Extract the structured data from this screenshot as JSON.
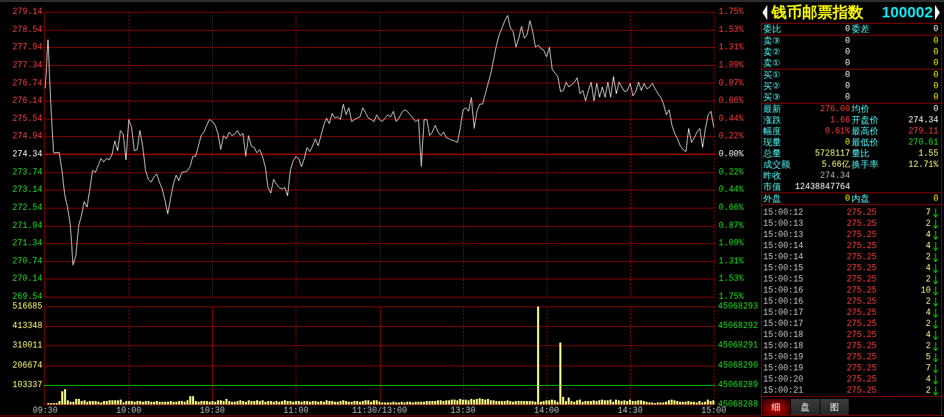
{
  "price_chart": {
    "percent_labels": [
      "1.75%",
      "1.53%",
      "1.31%",
      "1.09%",
      "0.87%",
      "0.66%",
      "0.44%",
      "0.22%",
      "0.00%",
      "0.22%",
      "0.44%",
      "0.66%",
      "0.87%",
      "1.09%",
      "1.31%",
      "1.53%",
      "1.75%"
    ],
    "chart_data": {
      "type": "line",
      "grid": true,
      "ref_lines": [
        {
          "axis": "y",
          "value": 274.34
        }
      ],
      "ylim": [
        269.54,
        279.14
      ],
      "yticks": [
        279.14,
        278.54,
        277.94,
        277.34,
        276.74,
        276.14,
        275.54,
        274.94,
        274.34,
        273.74,
        273.14,
        272.54,
        271.94,
        271.34,
        270.74,
        270.14,
        269.54
      ],
      "categories": [
        null,
        null,
        null,
        null,
        null,
        null,
        null,
        null,
        null,
        null,
        null,
        null,
        null,
        null,
        null,
        null,
        null,
        null,
        null,
        null,
        null,
        null,
        null,
        null,
        null,
        null,
        null,
        null,
        null,
        null,
        null,
        null,
        null,
        null,
        null,
        null,
        null,
        null,
        null,
        null,
        null,
        null,
        null,
        null,
        null,
        null,
        null,
        null,
        null,
        null,
        null,
        null,
        null,
        null,
        null,
        null,
        null,
        null,
        null,
        null,
        null,
        null,
        null,
        null,
        null,
        null,
        null,
        null,
        null,
        null,
        null,
        null,
        null,
        null,
        null,
        null,
        null,
        null,
        null,
        null,
        null,
        null,
        null,
        null,
        null,
        null,
        null,
        null,
        null,
        null,
        null,
        null,
        null,
        null,
        null,
        null,
        null,
        null,
        null,
        null,
        null,
        null,
        null,
        null,
        null,
        null,
        null,
        null,
        null,
        null,
        null,
        null,
        null,
        null,
        null,
        null,
        null,
        null,
        null,
        null,
        null,
        null,
        null,
        null,
        null,
        null,
        null,
        null,
        null,
        null,
        null,
        null,
        null,
        null,
        null,
        null,
        null,
        null,
        null,
        null,
        null,
        null,
        null,
        null,
        null,
        null,
        null,
        null,
        null,
        null,
        null,
        null,
        null,
        null,
        null,
        null,
        null,
        null,
        null,
        null,
        null,
        null,
        null,
        null,
        null,
        null,
        null,
        null,
        null,
        null,
        null,
        null,
        null,
        null,
        null,
        null,
        null,
        null,
        null,
        null,
        null,
        null,
        null,
        null,
        null,
        null,
        null,
        null,
        null,
        null,
        null,
        null,
        null,
        null,
        null,
        null,
        null,
        null,
        null,
        null,
        null,
        null,
        null,
        null,
        null,
        null,
        null,
        null,
        null,
        null,
        null,
        null,
        null,
        null,
        null,
        null,
        null,
        null,
        null,
        null,
        null,
        null,
        null,
        null,
        null,
        null,
        null,
        null,
        null,
        null,
        null,
        null,
        null,
        null,
        null,
        null,
        null,
        null,
        null,
        null,
        null
      ],
      "values": [
        276.56,
        278.2,
        276.03,
        274.39,
        274.39,
        274.41,
        273.8,
        272.98,
        272.56,
        271.98,
        270.61,
        270.92,
        271.93,
        272.28,
        272.75,
        272.56,
        273.15,
        273.8,
        273.73,
        273.96,
        274.2,
        274.08,
        274.2,
        274.15,
        274.34,
        274.79,
        274.46,
        275.14,
        275.02,
        274.15,
        275.51,
        275.25,
        274.46,
        274.5,
        275.14,
        274.62,
        273.8,
        273.5,
        273.4,
        273.57,
        273.68,
        273.4,
        273.17,
        272.79,
        272.33,
        272.86,
        273.33,
        273.64,
        273.45,
        273.73,
        273.75,
        273.78,
        273.92,
        274.27,
        274.27,
        274.62,
        274.97,
        275.09,
        275.32,
        275.51,
        275.44,
        275.32,
        275.04,
        274.5,
        274.97,
        274.86,
        275.09,
        274.97,
        275.02,
        275.14,
        274.97,
        275.04,
        274.27,
        274.97,
        274.62,
        274.57,
        274.39,
        274.5,
        274.27,
        273.92,
        273.22,
        273.03,
        273.5,
        273.33,
        273.22,
        273.17,
        273.22,
        272.94,
        273.8,
        274.11,
        274.27,
        274.2,
        273.92,
        274.2,
        274.57,
        274.43,
        274.62,
        274.86,
        274.62,
        274.97,
        275.32,
        275.56,
        275.37,
        275.72,
        275.56,
        275.6,
        275.51,
        276.03,
        275.67,
        275.91,
        275.44,
        275.51,
        275.56,
        275.6,
        275.91,
        275.74,
        275.56,
        275.51,
        275.44,
        275.67,
        275.51,
        275.44,
        275.56,
        275.67,
        275.6,
        275.79,
        275.44,
        275.56,
        275.74,
        275.84,
        275.79,
        275.67,
        275.56,
        275.44,
        275.51,
        273.92,
        275.51,
        275.51,
        274.97,
        275.09,
        275.32,
        275.09,
        274.97,
        275.09,
        274.9,
        274.86,
        274.81,
        274.79,
        274.74,
        275.21,
        275.84,
        275.91,
        275.79,
        276.26,
        275.21,
        275.79,
        276.03,
        276.03,
        276.38,
        276.73,
        277.08,
        277.55,
        278.02,
        278.37,
        278.6,
        278.84,
        279.02,
        278.6,
        278.48,
        277.95,
        278.25,
        278.65,
        278.25,
        278.37,
        278.84,
        278.48,
        277.95,
        278.02,
        277.9,
        277.85,
        277.62,
        277.95,
        277.2,
        277.08,
        276.96,
        276.45,
        276.49,
        276.77,
        276.61,
        276.68,
        276.77,
        276.92,
        276.38,
        276.49,
        276.14,
        276.49,
        276.77,
        276.14,
        276.73,
        276.26,
        276.61,
        276.26,
        276.77,
        276.26,
        276.96,
        276.38,
        276.77,
        276.61,
        276.45,
        276.49,
        276.73,
        276.31,
        276.45,
        276.77,
        276.49,
        276.73,
        276.54,
        276.61,
        276.73,
        276.54,
        276.38,
        276.26,
        276.03,
        275.67,
        275.84,
        275.32,
        275.04,
        274.86,
        274.62,
        274.5,
        274.43,
        275.21,
        274.74,
        274.9,
        275.09,
        275.21,
        274.57,
        275.21,
        275.67,
        275.79,
        275.25
      ]
    }
  },
  "volume_chart": {
    "right_labels": [
      "45068293",
      "45068292",
      "45068291",
      "45068290",
      "45068289",
      "45068288"
    ],
    "chart_data": {
      "type": "bar",
      "grid": true,
      "ref_lines": [
        {
          "axis": "y",
          "value": 103337
        }
      ],
      "ylim": [
        0,
        516685
      ],
      "yticks": [
        516685,
        413348,
        310011,
        206674,
        103337
      ],
      "categories": [
        "09:30",
        null,
        null,
        null,
        null,
        null,
        null,
        null,
        null,
        null,
        null,
        null,
        null,
        null,
        null,
        null,
        null,
        null,
        null,
        null,
        null,
        null,
        null,
        null,
        null,
        null,
        null,
        null,
        null,
        null,
        "10:00",
        null,
        null,
        null,
        null,
        null,
        null,
        null,
        null,
        null,
        null,
        null,
        null,
        null,
        null,
        null,
        null,
        null,
        null,
        null,
        null,
        null,
        null,
        null,
        null,
        null,
        null,
        null,
        null,
        null,
        "10:30",
        null,
        null,
        null,
        null,
        null,
        null,
        null,
        null,
        null,
        null,
        null,
        null,
        null,
        null,
        null,
        null,
        null,
        null,
        null,
        null,
        null,
        null,
        null,
        null,
        null,
        null,
        null,
        null,
        null,
        "11:00",
        null,
        null,
        null,
        null,
        null,
        null,
        null,
        null,
        null,
        null,
        null,
        null,
        null,
        null,
        null,
        null,
        null,
        null,
        null,
        null,
        null,
        null,
        null,
        null,
        null,
        null,
        null,
        null,
        null,
        "11:30/13:00",
        null,
        null,
        null,
        null,
        null,
        null,
        null,
        null,
        null,
        null,
        null,
        null,
        null,
        null,
        null,
        null,
        null,
        null,
        null,
        null,
        null,
        null,
        null,
        null,
        null,
        null,
        null,
        null,
        null,
        "13:30",
        null,
        null,
        null,
        null,
        null,
        null,
        null,
        null,
        null,
        null,
        null,
        null,
        null,
        null,
        null,
        null,
        null,
        null,
        null,
        null,
        null,
        null,
        null,
        null,
        null,
        null,
        null,
        null,
        null,
        "14:00",
        null,
        null,
        null,
        null,
        null,
        null,
        null,
        null,
        null,
        null,
        null,
        null,
        null,
        null,
        null,
        null,
        null,
        null,
        null,
        null,
        null,
        null,
        null,
        null,
        null,
        null,
        null,
        null,
        null,
        "14:30",
        null,
        null,
        null,
        null,
        null,
        null,
        null,
        null,
        null,
        null,
        null,
        null,
        null,
        null,
        null,
        null,
        null,
        null,
        null,
        null,
        null,
        null,
        null,
        null,
        null,
        null,
        null,
        null,
        null,
        "15:00"
      ],
      "values": [
        null,
        7000,
        7000,
        7000,
        7000,
        18000,
        70000,
        81000,
        22000,
        15000,
        15000,
        29000,
        29000,
        18000,
        22000,
        15000,
        18000,
        18000,
        18000,
        15000,
        11000,
        18000,
        18000,
        22000,
        22000,
        22000,
        22000,
        26000,
        11000,
        18000,
        18000,
        18000,
        15000,
        18000,
        18000,
        15000,
        18000,
        18000,
        15000,
        15000,
        18000,
        15000,
        15000,
        15000,
        15000,
        18000,
        15000,
        15000,
        18000,
        18000,
        15000,
        22000,
        44000,
        44000,
        18000,
        15000,
        18000,
        18000,
        18000,
        15000,
        18000,
        15000,
        22000,
        22000,
        18000,
        29000,
        18000,
        15000,
        15000,
        18000,
        22000,
        18000,
        15000,
        22000,
        18000,
        18000,
        22000,
        18000,
        22000,
        15000,
        18000,
        18000,
        15000,
        18000,
        15000,
        18000,
        22000,
        18000,
        18000,
        15000,
        18000,
        18000,
        15000,
        18000,
        18000,
        15000,
        18000,
        18000,
        15000,
        18000,
        15000,
        22000,
        18000,
        18000,
        15000,
        15000,
        18000,
        22000,
        18000,
        15000,
        15000,
        18000,
        18000,
        15000,
        18000,
        22000,
        22000,
        15000,
        22000,
        22000,
        15000,
        11000,
        11000,
        11000,
        11000,
        15000,
        11000,
        11000,
        15000,
        11000,
        15000,
        15000,
        11000,
        15000,
        15000,
        15000,
        15000,
        18000,
        18000,
        18000,
        18000,
        22000,
        22000,
        18000,
        22000,
        22000,
        26000,
        26000,
        22000,
        29000,
        26000,
        26000,
        22000,
        29000,
        26000,
        29000,
        33000,
        29000,
        26000,
        29000,
        22000,
        22000,
        18000,
        18000,
        18000,
        18000,
        22000,
        18000,
        15000,
        18000,
        18000,
        18000,
        18000,
        18000,
        18000,
        18000,
        15000,
        516000,
        15000,
        18000,
        22000,
        22000,
        26000,
        22000,
        15000,
        326000,
        40000,
        18000,
        37000,
        18000,
        15000,
        22000,
        26000,
        15000,
        18000,
        18000,
        18000,
        22000,
        18000,
        22000,
        26000,
        22000,
        22000,
        26000,
        15000,
        26000,
        22000,
        18000,
        22000,
        18000,
        26000,
        18000,
        18000,
        22000,
        22000,
        18000,
        15000,
        11000,
        11000,
        7000,
        11000,
        11000,
        11000,
        15000,
        22000,
        26000,
        22000,
        18000,
        15000,
        15000,
        15000,
        18000,
        15000,
        15000,
        11000,
        18000,
        11000,
        15000,
        26000,
        18000,
        22000
      ]
    }
  },
  "quote_panel": {
    "header": {
      "title": "钱币邮票指数",
      "code": "100002"
    },
    "order_summary": [
      {
        "label": "委比",
        "value": "0"
      },
      {
        "label": "委差",
        "value": "0"
      }
    ],
    "asks": [
      {
        "label": "卖③",
        "price": "0",
        "volume": "0"
      },
      {
        "label": "卖②",
        "price": "0",
        "volume": "0"
      },
      {
        "label": "卖①",
        "price": "0",
        "volume": "0"
      }
    ],
    "bids": [
      {
        "label": "买①",
        "price": "0",
        "volume": "0"
      },
      {
        "label": "买②",
        "price": "0",
        "volume": "0"
      },
      {
        "label": "买③",
        "price": "0",
        "volume": "0"
      }
    ],
    "quote_rows": [
      {
        "cells": [
          {
            "label": "最新",
            "value": "276.00",
            "color": "#ff3c3c"
          },
          {
            "label": "均价",
            "value": "0",
            "color": "#ffffff"
          }
        ]
      },
      {
        "cells": [
          {
            "label": "涨跌",
            "value": "1.66",
            "color": "#ff3c3c"
          },
          {
            "label": "开盘价",
            "value": "274.34",
            "color": "#ffffff"
          }
        ]
      },
      {
        "cells": [
          {
            "label": "幅度",
            "value": "0.61%",
            "color": "#ff3c3c"
          },
          {
            "label": "最高价",
            "value": "279.11",
            "color": "#ff3c3c"
          }
        ]
      },
      {
        "cells": [
          {
            "label": "现量",
            "value": "0",
            "color": "#ffff00"
          },
          {
            "label": "最低价",
            "value": "270.61",
            "color": "#20e020"
          }
        ]
      },
      {
        "cells": [
          {
            "label": "总量",
            "value": "5728117",
            "color": "#ffff80"
          },
          {
            "label": "量比",
            "value": "1.55",
            "color": "#ffff80"
          }
        ]
      },
      {
        "cells": [
          {
            "label": "成交额",
            "value": "5.66亿",
            "color": "#ffff80"
          },
          {
            "label": "换手率",
            "value": "12.71%",
            "color": "#ffff80"
          }
        ]
      },
      {
        "cells": [
          {
            "label": "昨收",
            "value": "274.34",
            "color": "#b4b4b4"
          }
        ]
      },
      {
        "cells": [
          {
            "label": "市值",
            "value": "12438847764",
            "color": "#ffffff"
          }
        ]
      }
    ],
    "trade_split": [
      {
        "label": "外盘",
        "value": "0"
      },
      {
        "label": "内盘",
        "value": "0"
      }
    ],
    "ticks": [
      {
        "time": "15:00:12",
        "price": "275.25",
        "volume": "7",
        "down": true
      },
      {
        "time": "15:00:13",
        "price": "275.25",
        "volume": "2",
        "down": true
      },
      {
        "time": "15:00:13",
        "price": "275.25",
        "volume": "4",
        "down": true
      },
      {
        "time": "15:00:14",
        "price": "275.25",
        "volume": "4",
        "down": true
      },
      {
        "time": "15:00:14",
        "price": "275.25",
        "volume": "2",
        "down": true
      },
      {
        "time": "15:00:15",
        "price": "275.25",
        "volume": "4",
        "down": true
      },
      {
        "time": "15:00:15",
        "price": "275.25",
        "volume": "2",
        "down": true
      },
      {
        "time": "15:00:16",
        "price": "275.25",
        "volume": "10",
        "down": true
      },
      {
        "time": "15:00:16",
        "price": "275.25",
        "volume": "2",
        "down": true
      },
      {
        "time": "15:00:17",
        "price": "275.25",
        "volume": "4",
        "down": true
      },
      {
        "time": "15:00:17",
        "price": "275.25",
        "volume": "2",
        "down": true
      },
      {
        "time": "15:00:18",
        "price": "275.25",
        "volume": "4",
        "down": true
      },
      {
        "time": "15:00:18",
        "price": "275.25",
        "volume": "2",
        "down": true
      },
      {
        "time": "15:00:19",
        "price": "275.25",
        "volume": "5",
        "down": true
      },
      {
        "time": "15:00:19",
        "price": "275.25",
        "volume": "7",
        "down": true
      },
      {
        "time": "15:00:20",
        "price": "275.25",
        "volume": "4",
        "down": true
      },
      {
        "time": "15:00:21",
        "price": "275.25",
        "volume": "2",
        "down": true
      }
    ],
    "tabs": [
      {
        "label": "细",
        "selected": true
      },
      {
        "label": "盘",
        "selected": false
      },
      {
        "label": "图",
        "selected": false
      }
    ]
  }
}
